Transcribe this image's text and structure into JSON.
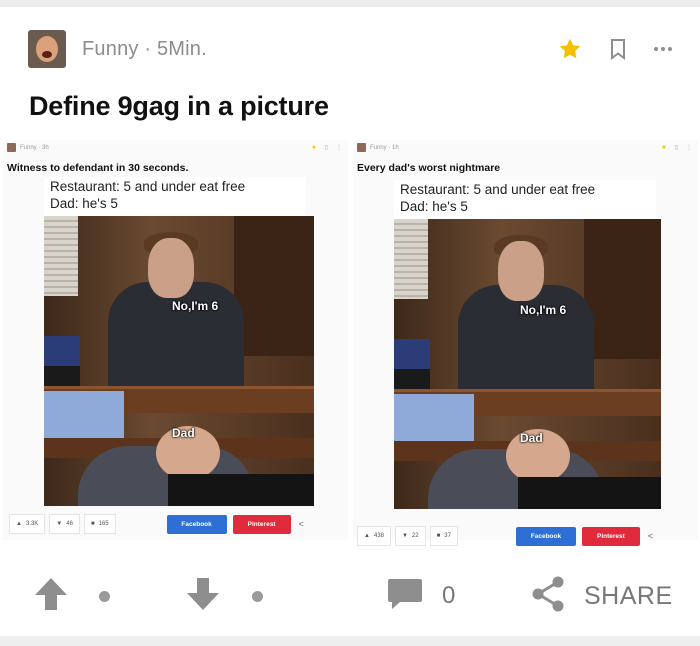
{
  "post": {
    "section": "Funny",
    "age": "5Min.",
    "meta_text": "Funny · 5Min.",
    "title": "Define 9gag in a picture"
  },
  "colors": {
    "star": "#f5c000",
    "facebook": "#2d6fd4",
    "pinterest": "#df2b3b",
    "icon_gray": "#8e8e8e"
  },
  "icons": [
    "star-icon",
    "bookmark-icon",
    "more-icon",
    "upvote-icon",
    "downvote-icon",
    "comment-icon",
    "share-icon"
  ],
  "panels": [
    {
      "meta": "Funny · 3h",
      "title": "Witness to defendant in 30 seconds.",
      "caption_line1": "Restaurant: 5 and under eat free",
      "caption_line2": "Dad: he's 5",
      "label_top": "No,I'm 6",
      "label_bottom": "Dad",
      "upvotes": "3.3K",
      "downvotes": "46",
      "comments": "165",
      "facebook": "Facebook",
      "pinterest": "Pinterest"
    },
    {
      "meta": "Funny · 1h",
      "title": "Every dad's worst nightmare",
      "caption_line1": "Restaurant: 5 and under eat free",
      "caption_line2": "Dad: he's 5",
      "label_top": "No,I'm 6",
      "label_bottom": "Dad",
      "upvotes": "438",
      "downvotes": "22",
      "comments": "37",
      "facebook": "Facebook",
      "pinterest": "Pinterest"
    }
  ],
  "bottom_bar": {
    "comment_count": "0",
    "share_label": "SHARE"
  }
}
